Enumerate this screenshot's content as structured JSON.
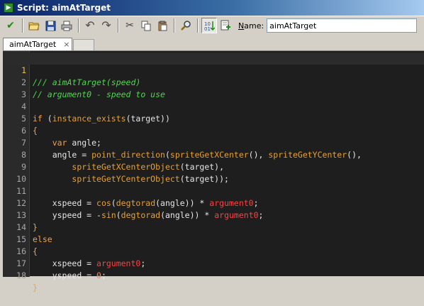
{
  "window": {
    "title": "Script: aimAtTarget",
    "app_icon": "script-icon"
  },
  "toolbar": {
    "buttons": [
      {
        "name": "confirm-button",
        "icon": "checkmark-icon",
        "glyph": "✔",
        "color": "#1a8a1a"
      },
      {
        "name": "open-button",
        "icon": "folder-open-icon",
        "glyph": "📂",
        "color": "#c8a030"
      },
      {
        "name": "save-button",
        "icon": "floppy-disk-icon",
        "glyph": "💾",
        "color": "#2050a0"
      },
      {
        "name": "print-button",
        "icon": "printer-icon",
        "glyph": "🖶",
        "color": "#505050"
      },
      {
        "name": "undo-button",
        "icon": "undo-icon",
        "glyph": "↶",
        "color": "#404040"
      },
      {
        "name": "redo-button",
        "icon": "redo-icon",
        "glyph": "↷",
        "color": "#404040"
      },
      {
        "name": "cut-button",
        "icon": "scissors-icon",
        "glyph": "✂",
        "color": "#404040"
      },
      {
        "name": "copy-button",
        "icon": "copy-icon",
        "glyph": "⧉",
        "color": "#404040"
      },
      {
        "name": "paste-button",
        "icon": "clipboard-icon",
        "glyph": "📋",
        "color": "#404040"
      },
      {
        "name": "find-button",
        "icon": "magnifier-icon",
        "glyph": "🔍",
        "color": "#404040"
      },
      {
        "name": "sort-button",
        "icon": "sort-icon",
        "glyph": "⇅",
        "color": "#2050a0"
      },
      {
        "name": "insert-button",
        "icon": "document-add-icon",
        "glyph": "📄",
        "color": "#1a8a1a"
      }
    ],
    "name_label_key": "N",
    "name_label_rest": "ame:",
    "name_value": "aimAtTarget"
  },
  "tabs": [
    {
      "label": "aimAtTarget",
      "close": "×"
    }
  ],
  "editor": {
    "current_line": 1,
    "lines": [
      {
        "n": "1"
      },
      {
        "n": "2"
      },
      {
        "n": "3"
      },
      {
        "n": "4"
      },
      {
        "n": "5"
      },
      {
        "n": "6"
      },
      {
        "n": "7"
      },
      {
        "n": "8"
      },
      {
        "n": "9"
      },
      {
        "n": "10"
      },
      {
        "n": "11"
      },
      {
        "n": "12"
      },
      {
        "n": "13"
      },
      {
        "n": "14"
      },
      {
        "n": "15"
      },
      {
        "n": "16"
      },
      {
        "n": "17"
      },
      {
        "n": "18"
      }
    ],
    "code": {
      "l1": "/// aimAtTarget(speed)",
      "l2": "// argument0 - speed to use",
      "l4_if": "if",
      "l4_space": " (",
      "l4_fn": "instance_exists",
      "l4_rest": "(target))",
      "l5": "{",
      "l6_kw": "var",
      "l6_rest": " angle;",
      "l7_a": "angle = ",
      "l7_fn1": "point_direction",
      "l7_b": "(",
      "l7_fn2": "spriteGetXCenter",
      "l7_c": "(), ",
      "l7_fn3": "spriteGetYCenter",
      "l7_d": "(),",
      "l8_fn": "spriteGetXCenterObject",
      "l8_rest": "(target),",
      "l9_fn": "spriteGetYCenterObject",
      "l9_rest": "(target));",
      "l11_a": "xspeed = ",
      "l11_fn1": "cos",
      "l11_b": "(",
      "l11_fn2": "degtorad",
      "l11_c": "(angle)) * ",
      "l11_arg": "argument0",
      "l11_d": ";",
      "l12_a": "yspeed = -",
      "l12_fn1": "sin",
      "l12_b": "(",
      "l12_fn2": "degtorad",
      "l12_c": "(angle)) * ",
      "l12_arg": "argument0",
      "l12_d": ";",
      "l13": "}",
      "l14": "else",
      "l15": "{",
      "l16_a": "xspeed = ",
      "l16_arg": "argument0",
      "l16_b": ";",
      "l17_a": "yspeed = ",
      "l17_num": "0",
      "l17_b": ";",
      "l18": "}"
    }
  }
}
